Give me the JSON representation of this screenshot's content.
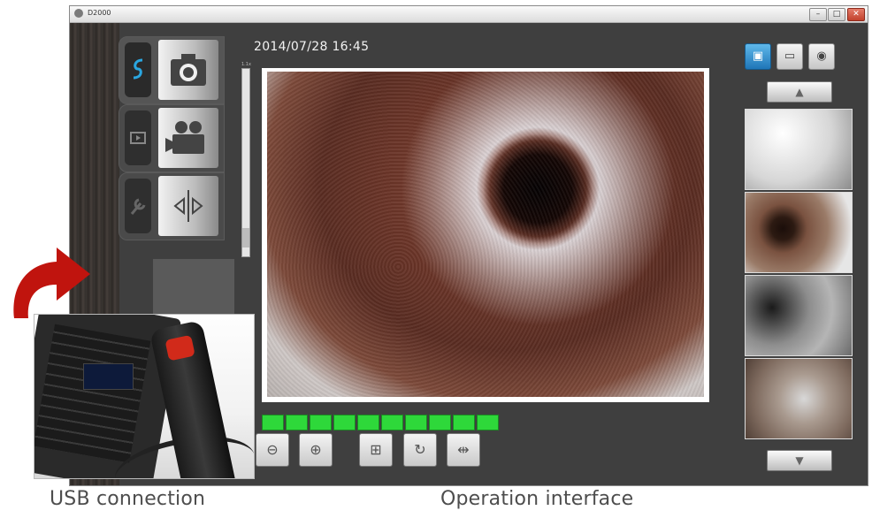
{
  "window": {
    "title": "D2000",
    "minimize_glyph": "–",
    "maximize_glyph": "□",
    "close_glyph": "✕"
  },
  "mode_tabs": [
    {
      "name": "capture-photo",
      "side_icon": "usb-icon",
      "main_icon": "camera-icon",
      "active": true
    },
    {
      "name": "record-video",
      "side_icon": "playback-icon",
      "main_icon": "video-camera-icon",
      "active": false
    },
    {
      "name": "compare",
      "side_icon": "wrench-icon",
      "main_icon": "split-compare-icon",
      "active": false
    }
  ],
  "zoom_scale_caption": "1.1x",
  "datetime": "2014/07/28 16:45",
  "zoom_level": {
    "filled": 10,
    "total": 10
  },
  "toolbar": {
    "buttons": [
      {
        "name": "light-down-button",
        "icon": "bulb-minus-icon",
        "glyph": "⊖"
      },
      {
        "name": "light-up-button",
        "icon": "bulb-plus-icon",
        "glyph": "⊕"
      },
      {
        "name": "zoom-button",
        "icon": "zoom-icon",
        "glyph": "⊞"
      },
      {
        "name": "rotate-button",
        "icon": "rotate-icon",
        "glyph": "↻"
      },
      {
        "name": "mirror-button",
        "icon": "mirror-icon",
        "glyph": "⇹"
      }
    ]
  },
  "view_buttons": [
    {
      "name": "gallery-view-button",
      "icon": "gallery-icon",
      "glyph": "▣",
      "active": true
    },
    {
      "name": "image-view-button",
      "icon": "image-icon",
      "glyph": "▭",
      "active": false
    },
    {
      "name": "snapshot-view-button",
      "icon": "snapshot-icon",
      "glyph": "◉",
      "active": false
    }
  ],
  "thumbnail_nav": {
    "up_glyph": "▲",
    "down_glyph": "▼"
  },
  "thumbnails_count": 4,
  "captions": {
    "left": "USB connection",
    "right": "Operation interface"
  },
  "colors": {
    "level_bar": "#2ed83a",
    "active_view_button": "#2a8fd4",
    "arrow": "#c0140e"
  }
}
